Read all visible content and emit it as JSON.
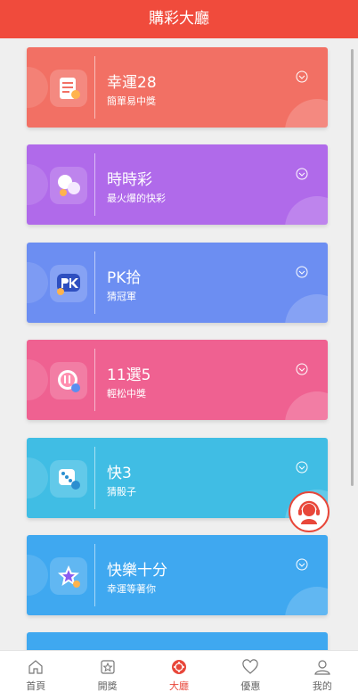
{
  "header": {
    "title": "購彩大廳"
  },
  "games": [
    {
      "title": "幸運28",
      "subtitle": "簡單易中獎",
      "color": "#f27064",
      "icon": "lottery-ticket-icon"
    },
    {
      "title": "時時彩",
      "subtitle": "最火爆的快彩",
      "color": "#b06aea",
      "icon": "balls-icon"
    },
    {
      "title": "PK拾",
      "subtitle": "猜冠軍",
      "color": "#6c8ef2",
      "icon": "pk-icon"
    },
    {
      "title": "11選5",
      "subtitle": "輕松中獎",
      "color": "#ef6191",
      "icon": "eleven-ball-icon"
    },
    {
      "title": "快3",
      "subtitle": "猜骰子",
      "color": "#40bde4",
      "icon": "dice-icon"
    },
    {
      "title": "快樂十分",
      "subtitle": "幸運等著你",
      "color": "#3fa8f0",
      "icon": "star-icon"
    },
    {
      "title": "",
      "subtitle": "",
      "color": "#3fa8f0",
      "icon": ""
    }
  ],
  "tabs": [
    {
      "label": "首頁",
      "icon": "home-icon",
      "active": false
    },
    {
      "label": "開獎",
      "icon": "draw-icon",
      "active": false
    },
    {
      "label": "大廳",
      "icon": "lobby-icon",
      "active": true
    },
    {
      "label": "優惠",
      "icon": "heart-icon",
      "active": false
    },
    {
      "label": "我的",
      "icon": "user-icon",
      "active": false
    }
  ],
  "colors": {
    "header": "#f04b3c",
    "active_tab": "#e8473a"
  }
}
